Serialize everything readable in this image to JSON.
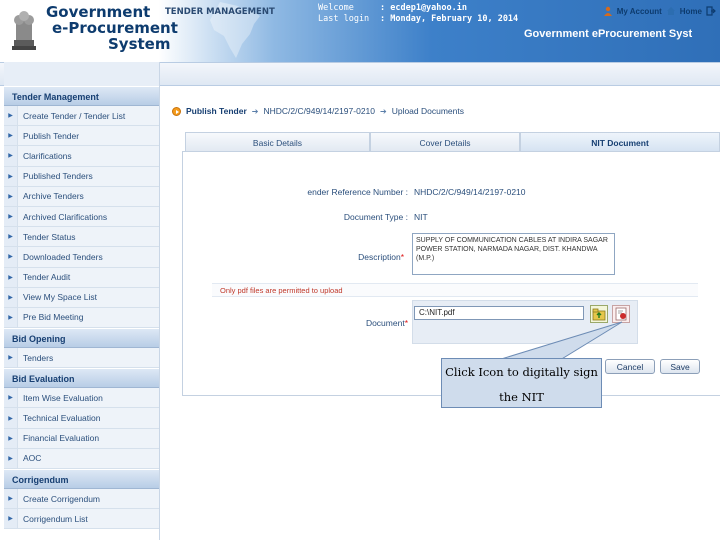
{
  "header": {
    "brand_line1": "Government",
    "brand_line2": "e-Procurement",
    "brand_line3": "System",
    "welcome_label": "Welcome",
    "welcome_value": ": ecdep1@yahoo.in",
    "last_login_label": "Last login",
    "last_login_value": ": Monday, February 10, 2014",
    "my_account": "My Account",
    "home": "Home",
    "portal_title": "Government eProcurement Syst"
  },
  "section": {
    "title": "TENDER MANAGEMENT"
  },
  "sidebar": {
    "groups": [
      {
        "title": "Tender Management",
        "items": [
          "Create Tender / Tender List",
          "Publish Tender",
          "Clarifications",
          "Published Tenders",
          "Archive Tenders",
          "Archived Clarifications",
          "Tender Status",
          "Downloaded Tenders",
          "Tender Audit",
          "View My Space List",
          "Pre Bid Meeting"
        ]
      },
      {
        "title": "Bid Opening",
        "items": [
          "Tenders"
        ]
      },
      {
        "title": "Bid Evaluation",
        "items": [
          "Item Wise Evaluation",
          "Technical Evaluation",
          "Financial Evaluation",
          "AOC"
        ]
      },
      {
        "title": "Corrigendum",
        "items": [
          "Create Corrigendum",
          "Corrigendum List"
        ]
      }
    ]
  },
  "breadcrumb": {
    "step1": "Publish Tender",
    "step2": "NHDC/2/C/949/14/2197-0210",
    "step3": "Upload Documents"
  },
  "tabs": [
    "Basic Details",
    "Cover Details",
    "NIT Document"
  ],
  "form": {
    "ref_label": "ender Reference Number :",
    "ref_value": "NHDC/2/C/949/14/2197-0210",
    "doctype_label": "Document Type :",
    "doctype_value": "NIT",
    "desc_label": "Description",
    "desc_value": "SUPPLY OF COMMUNICATION CABLES AT INDIRA SAGAR POWER STATION, NARMADA NAGAR, DIST. KHANDWA (M.P.)",
    "desc_required": "*",
    "warning": "Only pdf files are permitted to upload",
    "doc_label": "Document",
    "doc_required": "*",
    "doc_value": "C:\\NIT.pdf",
    "cancel_label": "Cancel",
    "save_label": "Save"
  },
  "callout": {
    "text": "Click Icon to digitally sign the NIT"
  },
  "colors": {
    "header_blue": "#3d80c9",
    "brand_navy": "#0d3b6e",
    "link_blue": "#2b4f7c",
    "warning_red": "#c0392b",
    "callout_fill": "#cfdcec"
  }
}
